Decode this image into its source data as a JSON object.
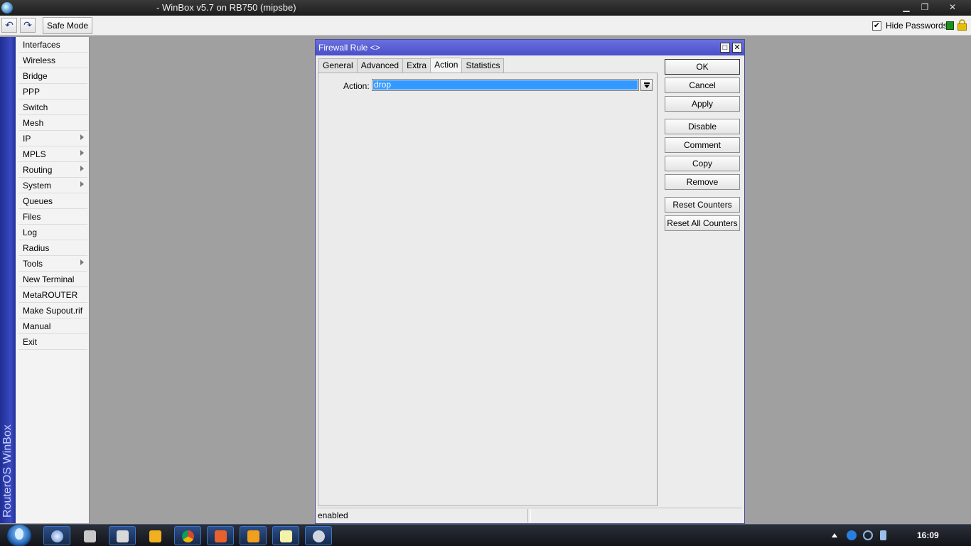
{
  "window": {
    "title": "- WinBox v5.7 on RB750 (mipsbe)",
    "controls": {
      "minimize": "▁",
      "restore": "❐",
      "close": "✕"
    }
  },
  "toolbar": {
    "undo_icon": "undo-icon",
    "redo_icon": "redo-icon",
    "undo_glyph": "↶",
    "redo_glyph": "↷",
    "safe_mode_label": "Safe Mode",
    "hide_passwords_label": "Hide Passwords",
    "hide_passwords_checked": "✔"
  },
  "sidebar": {
    "brand": "RouterOS WinBox",
    "items": [
      {
        "label": "Interfaces",
        "submenu": false
      },
      {
        "label": "Wireless",
        "submenu": false
      },
      {
        "label": "Bridge",
        "submenu": false
      },
      {
        "label": "PPP",
        "submenu": false
      },
      {
        "label": "Switch",
        "submenu": false
      },
      {
        "label": "Mesh",
        "submenu": false
      },
      {
        "label": "IP",
        "submenu": true
      },
      {
        "label": "MPLS",
        "submenu": true
      },
      {
        "label": "Routing",
        "submenu": true
      },
      {
        "label": "System",
        "submenu": true
      },
      {
        "label": "Queues",
        "submenu": false
      },
      {
        "label": "Files",
        "submenu": false
      },
      {
        "label": "Log",
        "submenu": false
      },
      {
        "label": "Radius",
        "submenu": false
      },
      {
        "label": "Tools",
        "submenu": true
      },
      {
        "label": "New Terminal",
        "submenu": false
      },
      {
        "label": "MetaROUTER",
        "submenu": false
      },
      {
        "label": "Make Supout.rif",
        "submenu": false
      },
      {
        "label": "Manual",
        "submenu": false
      },
      {
        "label": "Exit",
        "submenu": false
      }
    ]
  },
  "dialog": {
    "title": "Firewall Rule <>",
    "maximize_glyph": "□",
    "close_glyph": "✕",
    "tabs": [
      {
        "label": "General",
        "active": false
      },
      {
        "label": "Advanced",
        "active": false
      },
      {
        "label": "Extra",
        "active": false
      },
      {
        "label": "Action",
        "active": true
      },
      {
        "label": "Statistics",
        "active": false
      }
    ],
    "action_label": "Action:",
    "action_value": "drop",
    "buttons": {
      "ok": "OK",
      "cancel": "Cancel",
      "apply": "Apply",
      "disable": "Disable",
      "comment": "Comment",
      "copy": "Copy",
      "remove": "Remove",
      "reset_counters": "Reset Counters",
      "reset_all_counters": "Reset All Counters"
    },
    "status": "enabled"
  },
  "taskbar": {
    "clock": "16:09"
  },
  "colors": {
    "title_gradient_top": "#6a70e0",
    "selection": "#3399ff",
    "sidebar_strip": "#2b3ab0"
  }
}
